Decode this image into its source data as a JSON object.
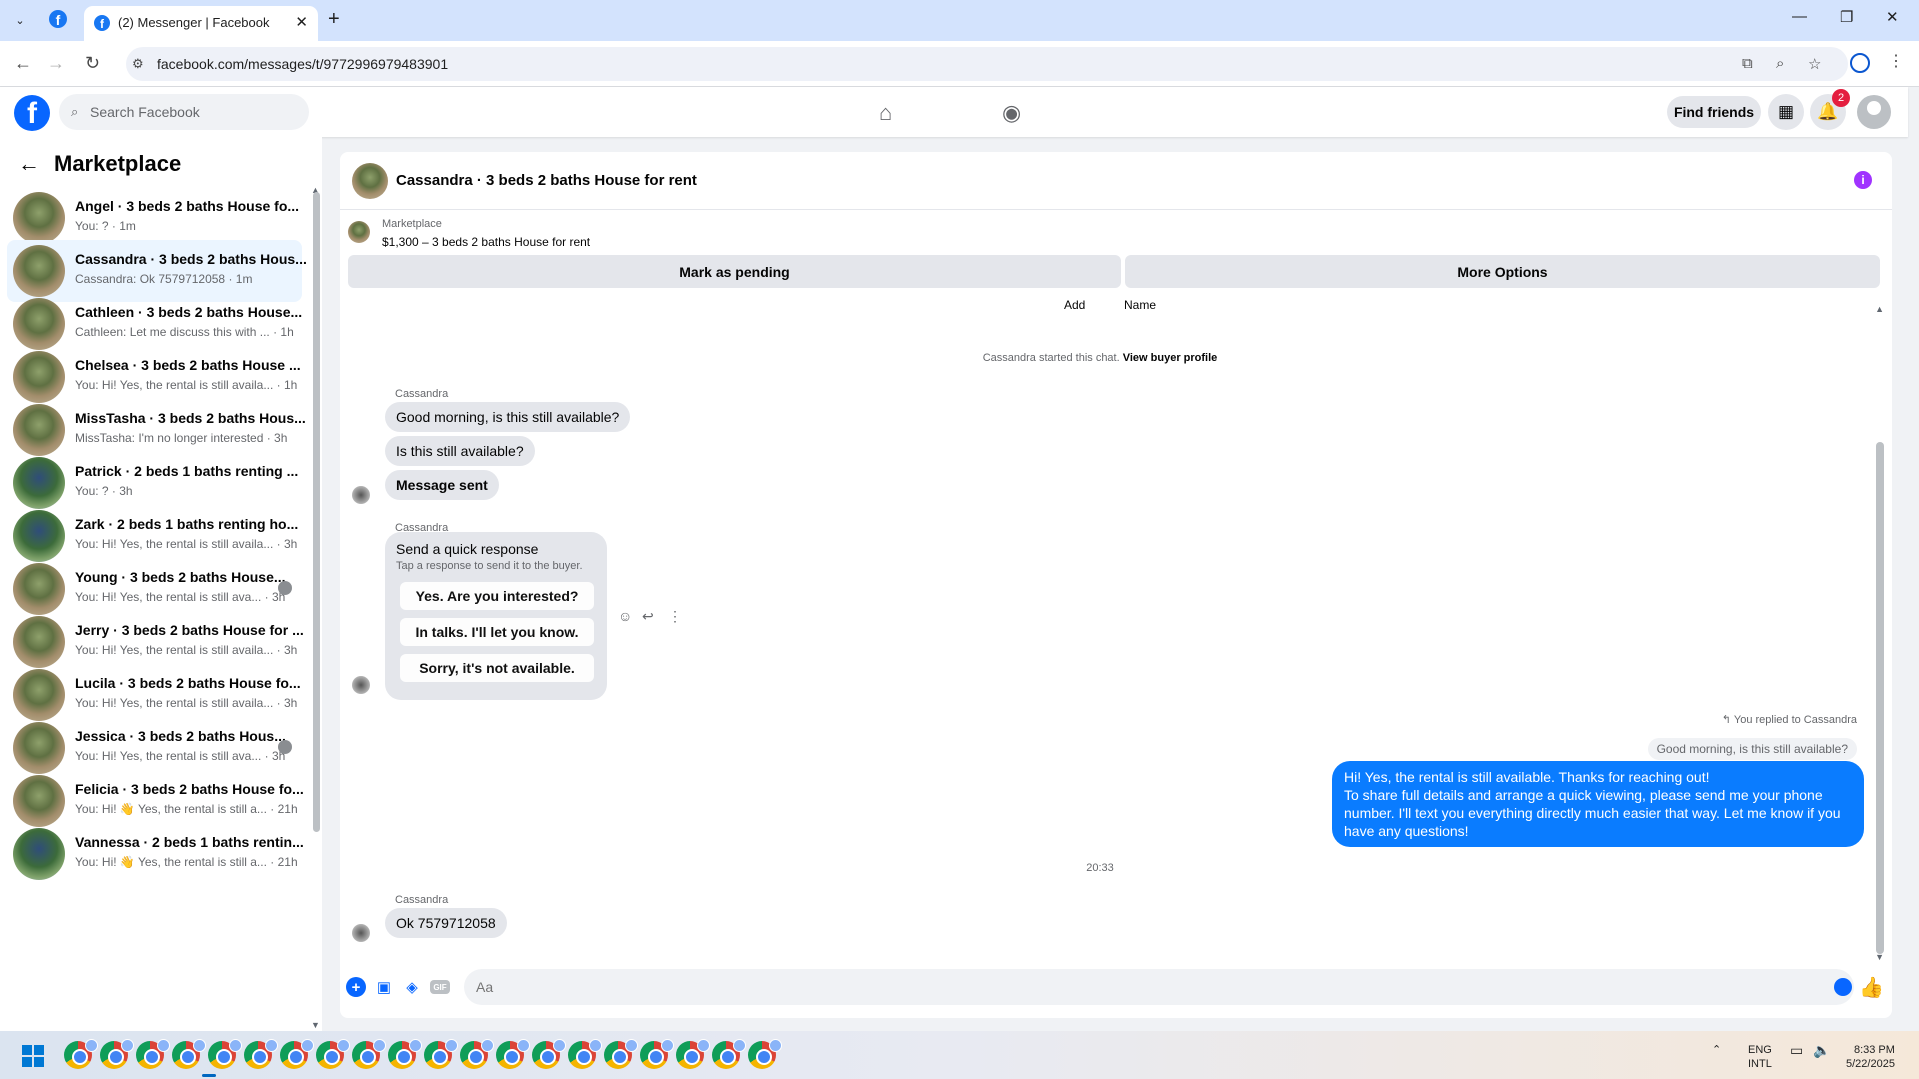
{
  "browser": {
    "tab_title": "(2) Messenger | Facebook",
    "url": "facebook.com/messages/t/9772996979483901",
    "new_tab": "+",
    "close_tab": "✕",
    "minimize": "—",
    "restore": "❐",
    "close_window": "✕"
  },
  "fb": {
    "search_placeholder": "Search Facebook",
    "find_friends": "Find friends",
    "notification_count": "2"
  },
  "sidebar": {
    "title": "Marketplace",
    "conversations": [
      {
        "name": "Angel · 3 beds 2 baths House fo...",
        "preview": "You: ? · 1m",
        "selected": false
      },
      {
        "name": "Cassandra · 3 beds 2 baths Hous...",
        "preview": "Cassandra: Ok 7579712058 · 1m",
        "selected": true
      },
      {
        "name": "Cathleen · 3 beds 2 baths House...",
        "preview": "Cathleen: Let me discuss this with ... · 1h"
      },
      {
        "name": "Chelsea · 3 beds 2 baths House ...",
        "preview": "You: Hi! Yes, the rental is still availa... · 1h"
      },
      {
        "name": "MissTasha · 3 beds 2 baths Hous...",
        "preview": "MissTasha: I'm no longer interested · 3h"
      },
      {
        "name": "Patrick · 2 beds 1 baths renting ...",
        "preview": "You: ? · 3h"
      },
      {
        "name": "Zark · 2 beds 1 baths renting ho...",
        "preview": "You: Hi! Yes, the rental is still availa... · 3h"
      },
      {
        "name": "Young · 3 beds 2 baths House...",
        "preview": "You: Hi! Yes, the rental is still ava... · 3h"
      },
      {
        "name": "Jerry · 3 beds 2 baths House for ...",
        "preview": "You: Hi! Yes, the rental is still availa... · 3h"
      },
      {
        "name": "Lucila · 3 beds 2 baths House fo...",
        "preview": "You: Hi! Yes, the rental is still availa... · 3h"
      },
      {
        "name": "Jessica · 3 beds 2 baths Hous...",
        "preview": "You: Hi! Yes, the rental is still ava... · 3h"
      },
      {
        "name": "Felicia · 3 beds 2 baths House fo...",
        "preview": "You: Hi! 👋 Yes, the rental is still a... · 21h"
      },
      {
        "name": "Vannessa · 2 beds 1 baths rentin...",
        "preview": "You: Hi! 👋 Yes, the rental is still a... · 21h"
      }
    ]
  },
  "chat": {
    "title": "Cassandra · 3 beds 2 baths House for rent",
    "listing_label": "Marketplace",
    "listing_price": "$1,300 – 3 beds 2 baths House for rent",
    "mark_pending": "Mark as pending",
    "more_options": "More Options",
    "add_label": "Add",
    "name_label": "Name",
    "started": "Cassandra started this chat.",
    "view_profile": "View buyer profile",
    "sender": "Cassandra",
    "msg1": "Good morning, is this still available?",
    "msg2": "Is this still available?",
    "msg3": "Message sent",
    "qr_title": "Send a quick response",
    "qr_sub": "Tap a response to send it to the buyer.",
    "qr_options": [
      "Yes. Are you interested?",
      "In talks. I'll let you know.",
      "Sorry, it's not available."
    ],
    "replied_to": "↰ You replied to Cassandra",
    "quoted": "Good morning, is this still available?",
    "my_reply": "Hi! Yes, the rental is still available. Thanks for reaching out!\nTo share full details and arrange a quick viewing, please send me your phone number. I'll text you everything directly much easier that way. Let me know if you have any questions!",
    "time": "20:33",
    "last_msg": "Ok 7579712058",
    "composer_placeholder": "Aa"
  },
  "taskbar": {
    "lang1": "ENG",
    "lang2": "INTL",
    "clock_time": "8:33 PM",
    "clock_date": "5/22/2025"
  },
  "colors": {
    "fb_blue": "#0866ff",
    "messenger_bubble": "#0a7cff",
    "selected_row": "#ebf5ff"
  }
}
